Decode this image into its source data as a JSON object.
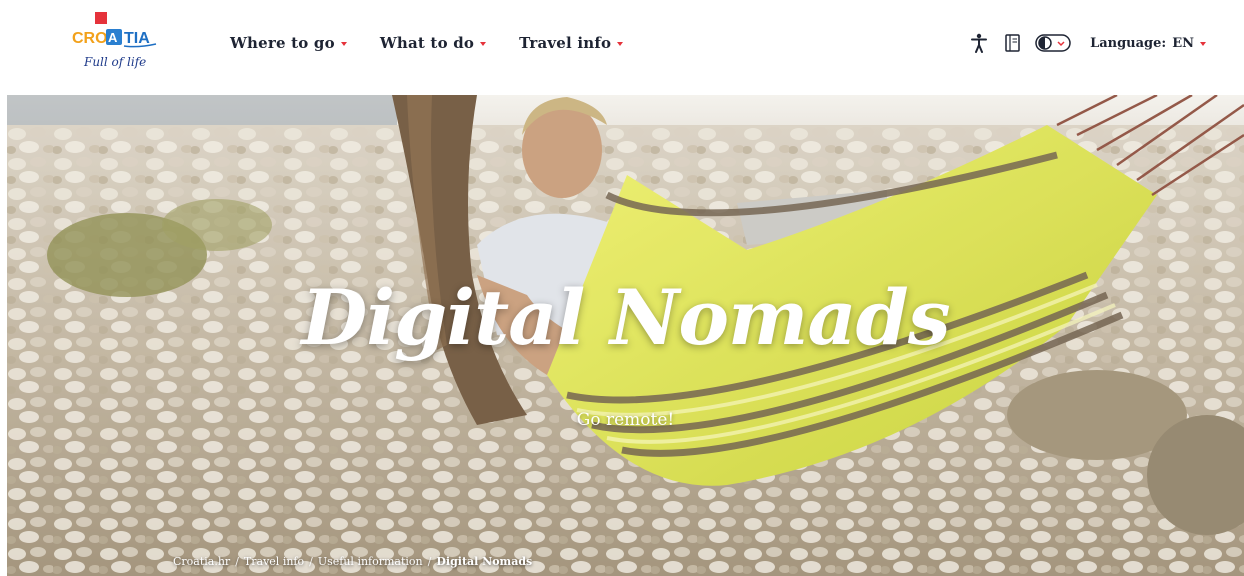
{
  "logo": {
    "wordmark": "CROATIA",
    "tagline": "Full of life"
  },
  "nav": {
    "items": [
      {
        "label": "Where to go"
      },
      {
        "label": "What to do"
      },
      {
        "label": "Travel info"
      }
    ]
  },
  "tools": {
    "accessibility_icon": "accessibility-person-icon",
    "guide_icon": "book-icon",
    "contrast_icon": "contrast-toggle-icon",
    "language_label": "Language:",
    "language_value": "EN"
  },
  "hero": {
    "title": "Digital Nomads",
    "subtitle": "Go remote!"
  },
  "breadcrumb": {
    "items": [
      "Croatia.hr",
      "Travel info",
      "Useful information"
    ],
    "separator": "/",
    "current": "Digital Nomads"
  },
  "colors": {
    "accent_red": "#e5323b",
    "nav_text": "#1e2433",
    "hammock_green": "#d3dc3c",
    "hammock_brown": "#6b5a45"
  }
}
